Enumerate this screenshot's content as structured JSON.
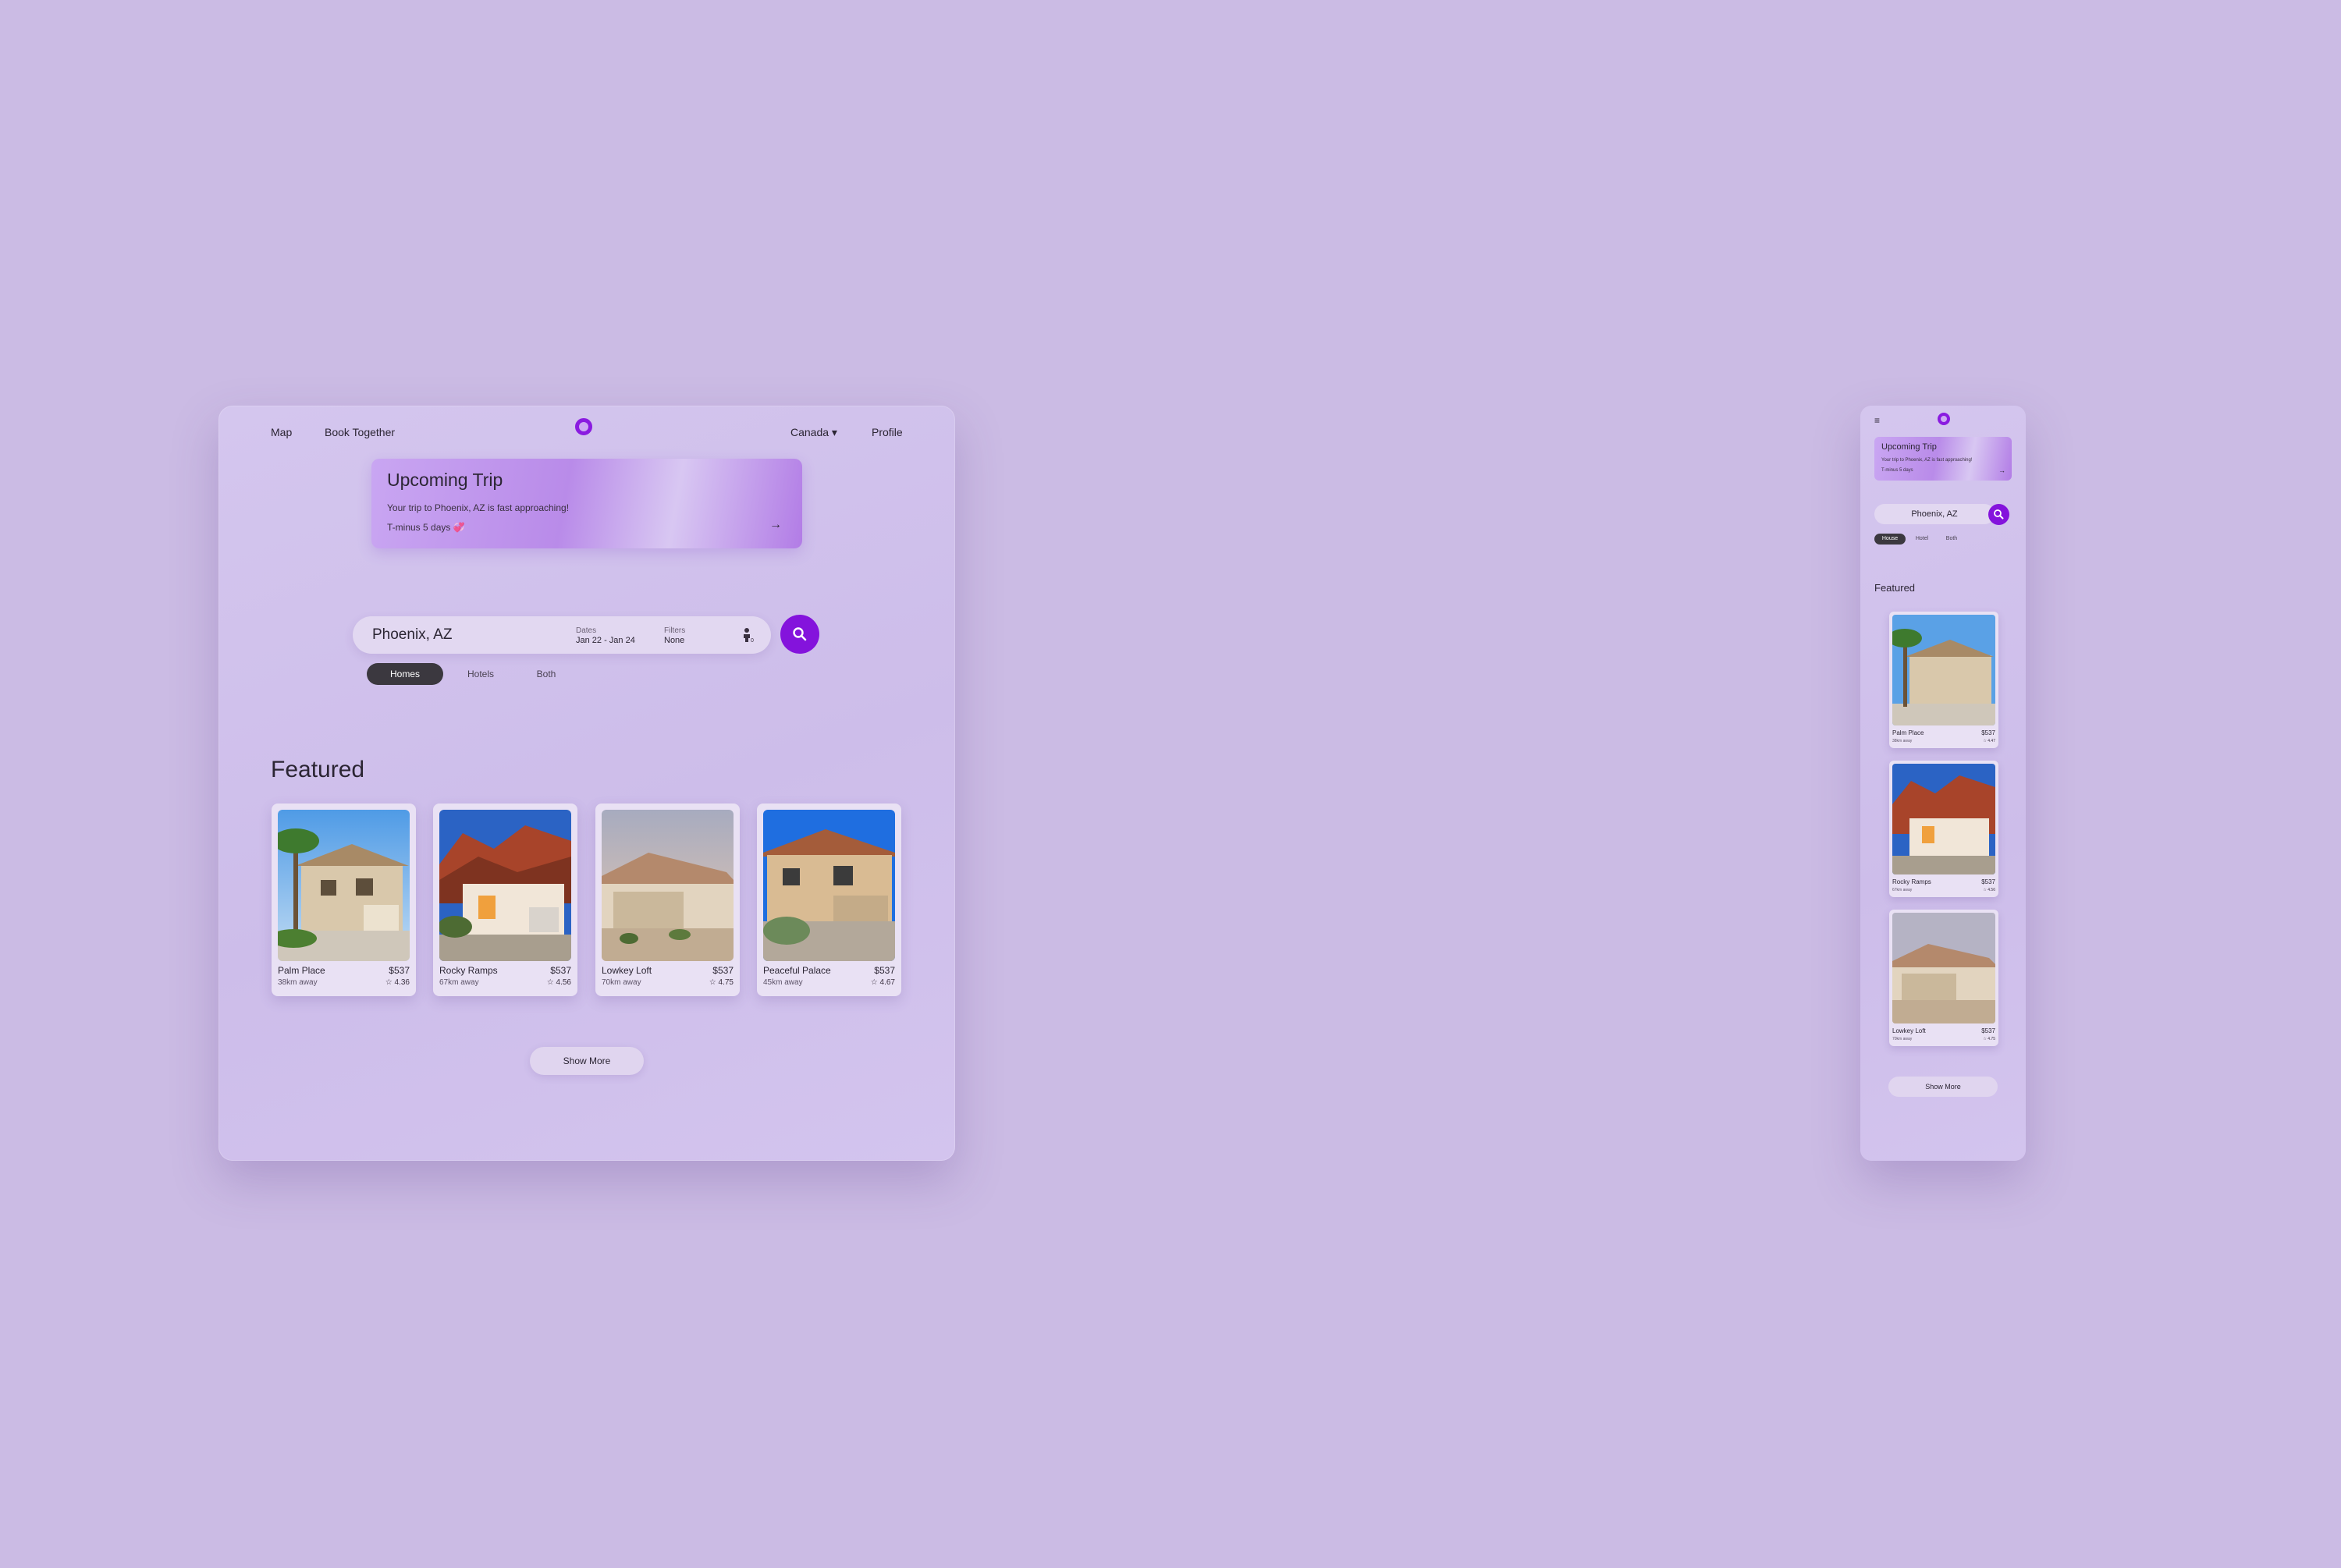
{
  "desktop": {
    "nav": {
      "map": "Map",
      "book_together": "Book Together",
      "country": "Canada ▾",
      "profile": "Profile"
    },
    "trip": {
      "title": "Upcoming Trip",
      "message": "Your trip to Phoenix, AZ is fast approaching!",
      "countdown": "T-minus 5 days 💞",
      "arrow": "→"
    },
    "search": {
      "location": "Phoenix, AZ",
      "dates_label": "Dates",
      "dates_value": "Jan 22 - Jan 24",
      "filters_label": "Filters",
      "filters_value": "None"
    },
    "tabs": [
      "Homes",
      "Hotels",
      "Both"
    ],
    "featured_title": "Featured",
    "cards": [
      {
        "name": "Palm Place",
        "price": "$537",
        "distance": "38km away",
        "rating": "☆ 4.36"
      },
      {
        "name": "Rocky Ramps",
        "price": "$537",
        "distance": "67km away",
        "rating": "☆ 4.56"
      },
      {
        "name": "Lowkey Loft",
        "price": "$537",
        "distance": "70km away",
        "rating": "☆ 4.75"
      },
      {
        "name": "Peaceful Palace",
        "price": "$537",
        "distance": "45km away",
        "rating": "☆ 4.67"
      }
    ],
    "show_more": "Show More"
  },
  "mobile": {
    "menu": "≡",
    "trip": {
      "title": "Upcoming Trip",
      "message": "Your trip to Phoenix, AZ is fast approaching!",
      "countdown": "T-minus 5 days",
      "arrow": "→"
    },
    "search_location": "Phoenix, AZ",
    "tabs": [
      "House",
      "Hotel",
      "Both"
    ],
    "featured_title": "Featured",
    "cards": [
      {
        "name": "Palm Place",
        "price": "$537",
        "distance": "38km away",
        "rating": "☆ 4.47"
      },
      {
        "name": "Rocky Ramps",
        "price": "$537",
        "distance": "67km away",
        "rating": "☆ 4.56"
      },
      {
        "name": "Lowkey Loft",
        "price": "$537",
        "distance": "70km away",
        "rating": "☆ 4.75"
      }
    ],
    "show_more": "Show More"
  },
  "colors": {
    "background": "#cbbbe4",
    "accent": "#8413dc",
    "active_pill": "#3b383f"
  },
  "icons": [
    "logo-ring-icon",
    "search-icon",
    "guest-icon",
    "arrow-right-icon",
    "star-icon",
    "menu-icon"
  ]
}
